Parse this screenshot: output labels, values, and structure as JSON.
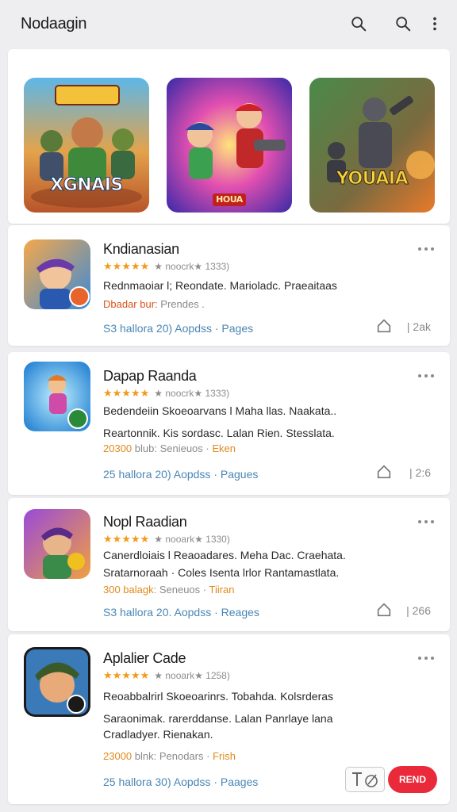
{
  "header": {
    "title": "Nodaagin"
  },
  "featured": [
    {
      "label": "XGNAIS"
    },
    {
      "label": "HOUA"
    },
    {
      "label": "YOUAIA"
    }
  ],
  "apps": [
    {
      "name": "Kndianasian",
      "stars": "★★★★★",
      "rating_text": "★ noocrk★ 1333)",
      "line1": "Rednmaoiar l; Reondate. Marioladc. Praeaitaas",
      "meta_hl": "Dbadar bur:",
      "meta_rest": " Prendes .",
      "links": "S3 hallora 20) Aopdss · Pages",
      "count": "| 2ak"
    },
    {
      "name": "Dapap Raanda",
      "stars": "★★★★★",
      "rating_text": "★ noocrk★ 1333)",
      "line1": "Bedendeiin Skoeoarvans l Maha llas. Naakata..",
      "line2": "Reartonnik. Kis sordasc. Lalan Rien. Stesslata.",
      "meta_hl": "20300",
      "meta_rest": " blub: Senieuos ·",
      "meta_red": " Eken",
      "links": "25 hallora 20) Aopdss · Pagues",
      "count": "| 2:6"
    },
    {
      "name": "Nopl Raadian",
      "stars": "★★★★★",
      "rating_text": "★ nooark★ 1330)",
      "line1": "Canerdloiais l Reaoadares. Meha Dac. Craehata.",
      "line2": "Sratarnoraah · Coles Isenta lrlor Rantamastlata.",
      "meta_hl": "300 balagk:",
      "meta_rest": " Seneuos ·",
      "meta_red": " Tiiran",
      "links": "S3 hallora 20. Aopdss · Reages",
      "count": "| 266"
    },
    {
      "name": "Aplalier Cade",
      "stars": "★★★★★",
      "rating_text": "★ nooark★ 1258)",
      "line1": "Reoabbalrirl Skoeoarinrs. Tobahda. Kolsrderas",
      "line2": "Saraonimak. rarerddanse. Lalan Panrlaye lana",
      "line3": "Cradladyer. Rienakan.",
      "meta_hl": "23000",
      "meta_rest": " blnk: Penodars ·",
      "meta_red": " Frish",
      "links": "25 hallora 30) Aopdss · Paages",
      "send_label": "REND"
    }
  ]
}
